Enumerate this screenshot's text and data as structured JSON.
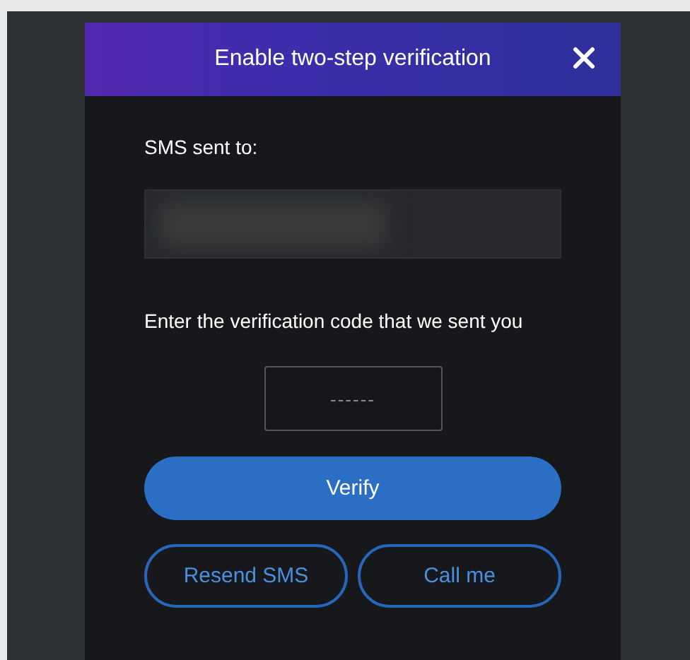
{
  "dialog": {
    "title": "Enable two-step verification",
    "sms_label": "SMS sent to:",
    "instruction": "Enter the verification code that we sent you",
    "code_field": {
      "placeholder": "------"
    },
    "primary_button": "Verify",
    "secondary_buttons": [
      "Resend SMS",
      "Call me"
    ]
  }
}
